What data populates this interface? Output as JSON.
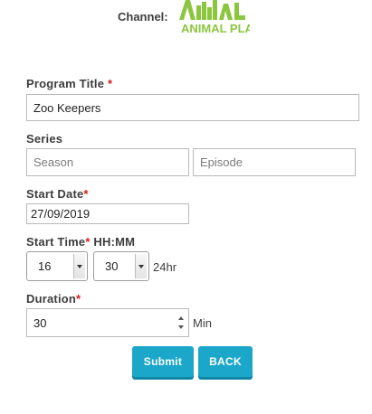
{
  "header": {
    "channel_label": "Channel:",
    "logo_alt": "ANIMAL PLANET",
    "logo_color": "#8cc63f"
  },
  "form": {
    "program_title": {
      "label": "Program Title",
      "required_mark": "*",
      "value": "Zoo Keepers"
    },
    "series": {
      "label": "Series",
      "season_placeholder": "Season",
      "episode_placeholder": "Episode"
    },
    "start_date": {
      "label": "Start Date",
      "required_mark": "*",
      "value": "27/09/2019"
    },
    "start_time": {
      "label": "Start Time",
      "required_mark": "*",
      "format": "HH:MM",
      "hour": "16",
      "minute": "30",
      "suffix": "24hr"
    },
    "duration": {
      "label": "Duration",
      "required_mark": "*",
      "value": "30",
      "unit": "Min"
    }
  },
  "actions": {
    "submit_label": "Submit",
    "back_label": "BACK",
    "button_color": "#1aa7c9"
  }
}
